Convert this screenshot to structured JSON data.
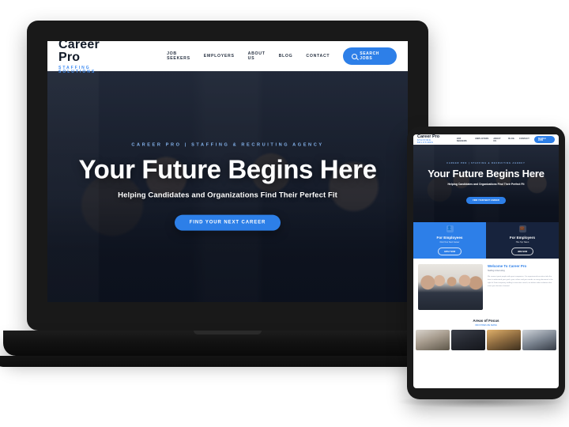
{
  "mockup": {
    "background_color": "#ffffff",
    "accent_color": "#2d7fe8",
    "dark_color": "#17233d",
    "device_frame_color": "#191919"
  },
  "site": {
    "logo": {
      "name": "Career Pro",
      "tagline": "STAFFING SOLUTIONS"
    },
    "nav": {
      "links": [
        {
          "label": "JOB SEEKERS"
        },
        {
          "label": "EMPLOYERS"
        },
        {
          "label": "ABOUT US"
        },
        {
          "label": "BLOG"
        },
        {
          "label": "CONTACT"
        }
      ],
      "search_button": "SEARCH JOBS",
      "search_icon": "search-icon"
    },
    "hero": {
      "eyebrow": "CAREER PRO  |  STAFFING & RECRUITING AGENCY",
      "headline": "Your Future Begins Here",
      "subheadline": "Helping Candidates and Organizations Find Their Perfect Fit",
      "cta_label": "FIND YOUR NEXT CAREER"
    },
    "panels": [
      {
        "title": "For Employees",
        "text": "Find Your Next Career",
        "button": "APPLY NOW",
        "icon": "user-icon",
        "color": "#2d7fe8"
      },
      {
        "title": "For Employers",
        "text": "Hire Top Talent",
        "button": "HIRE NOW",
        "icon": "briefcase-icon",
        "color": "#17233d"
      }
    ],
    "welcome": {
      "title_prefix": "Welcome To ",
      "title_accent": "Career Pro",
      "subtitle": "Staffing & Recruiting",
      "body": "We connect great people with great companies. Our experienced recruiters take the time to understand your goals, your culture and your needs so every placement is the right fit. From temporary staffing to executive search, we deliver talent solutions that move your business forward."
    },
    "focus": {
      "title": "Areas of Focus",
      "subtitle": "INDUSTRIES WE SERVE",
      "cards": [
        {
          "name": "focus-card-1"
        },
        {
          "name": "focus-card-2"
        },
        {
          "name": "focus-card-3"
        },
        {
          "name": "focus-card-4"
        }
      ]
    }
  }
}
